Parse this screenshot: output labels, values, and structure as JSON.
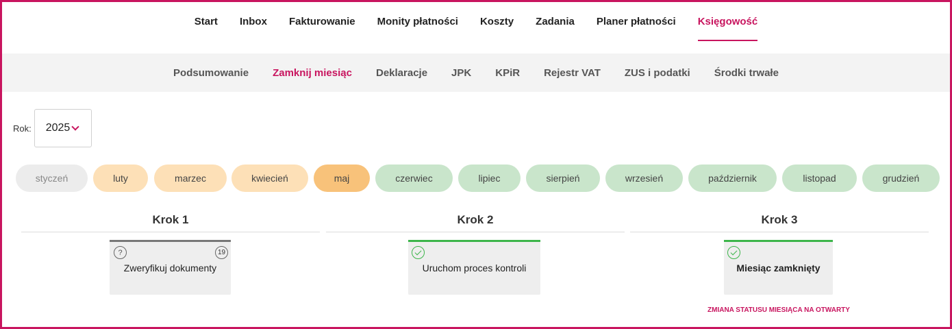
{
  "top_nav": {
    "items": [
      {
        "label": "Start",
        "active": false
      },
      {
        "label": "Inbox",
        "active": false
      },
      {
        "label": "Fakturowanie",
        "active": false
      },
      {
        "label": "Monity płatności",
        "active": false
      },
      {
        "label": "Koszty",
        "active": false
      },
      {
        "label": "Zadania",
        "active": false
      },
      {
        "label": "Planer płatności",
        "active": false
      },
      {
        "label": "Księgowość",
        "active": true
      }
    ]
  },
  "sub_nav": {
    "items": [
      {
        "label": "Podsumowanie",
        "active": false
      },
      {
        "label": "Zamknij miesiąc",
        "active": true
      },
      {
        "label": "Deklaracje",
        "active": false
      },
      {
        "label": "JPK",
        "active": false
      },
      {
        "label": "KPiR",
        "active": false
      },
      {
        "label": "Rejestr VAT",
        "active": false
      },
      {
        "label": "ZUS i podatki",
        "active": false
      },
      {
        "label": "Środki trwałe",
        "active": false
      }
    ]
  },
  "year": {
    "label": "Rok:",
    "value": "2025",
    "icon": "chevron-down-icon"
  },
  "months": [
    {
      "label": "styczeń",
      "status": "closed"
    },
    {
      "label": "luty",
      "status": "partial"
    },
    {
      "label": "marzec",
      "status": "partial"
    },
    {
      "label": "kwiecień",
      "status": "partial"
    },
    {
      "label": "maj",
      "status": "current"
    },
    {
      "label": "czerwiec",
      "status": "open"
    },
    {
      "label": "lipiec",
      "status": "open"
    },
    {
      "label": "sierpień",
      "status": "open"
    },
    {
      "label": "wrzesień",
      "status": "open"
    },
    {
      "label": "październik",
      "status": "open"
    },
    {
      "label": "listopad",
      "status": "open"
    },
    {
      "label": "grudzień",
      "status": "open"
    }
  ],
  "steps": [
    {
      "title": "Krok 1",
      "card_text": "Zweryfikuj dokumenty",
      "icon": "question-icon",
      "count": "19",
      "state": "pending"
    },
    {
      "title": "Krok 2",
      "card_text": "Uruchom proces kontroli",
      "icon": "check-icon",
      "state": "done"
    },
    {
      "title": "Krok 3",
      "card_text": "Miesiąc zamknięty",
      "icon": "check-icon",
      "state": "done"
    }
  ],
  "status_link": "ZMIANA STATUSU MIESIĄCA NA OTWARTY",
  "colors": {
    "accent": "#c8155f",
    "month_closed": "#ececec",
    "month_partial": "#fde0b7",
    "month_current": "#f8c27a",
    "month_open": "#c9e5cb",
    "done_bar": "#3cb54a"
  }
}
